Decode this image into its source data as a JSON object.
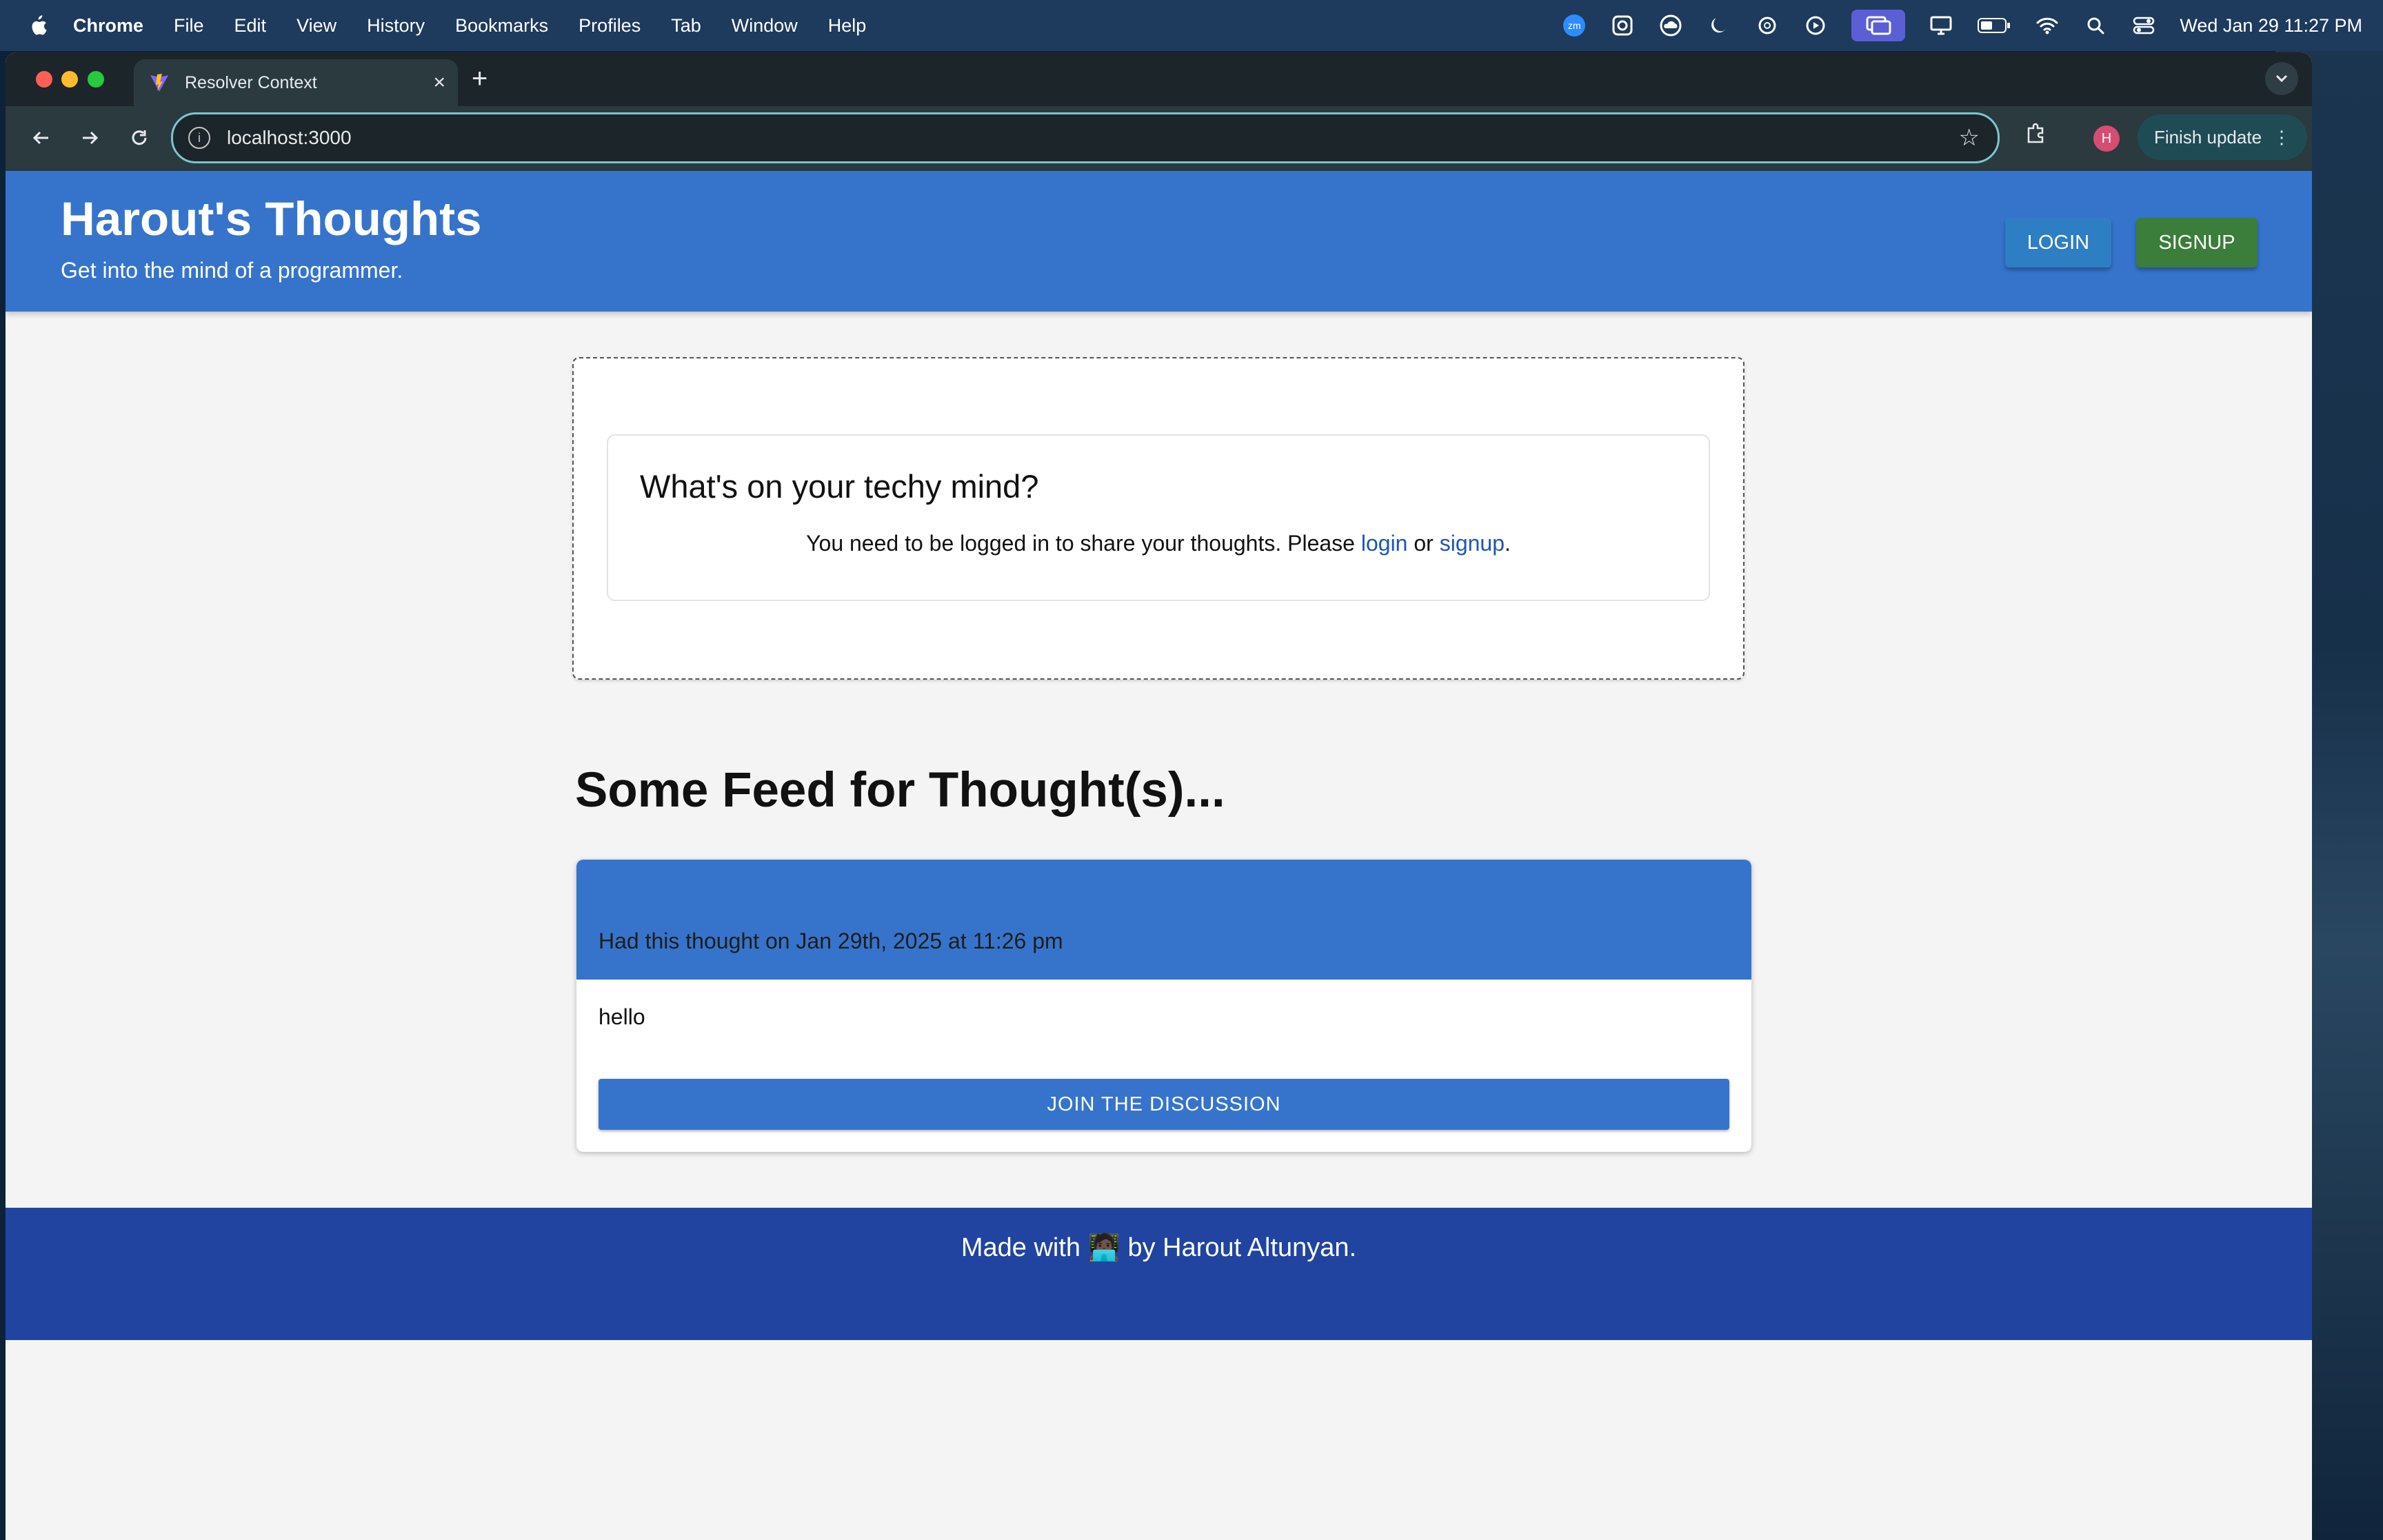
{
  "menubar": {
    "app_name": "Chrome",
    "menus": [
      "File",
      "Edit",
      "View",
      "History",
      "Bookmarks",
      "Profiles",
      "Tab",
      "Window",
      "Help"
    ],
    "clock": "Wed Jan 29  11:27 PM",
    "zoom_badge": "zm"
  },
  "browser": {
    "tab_title": "Resolver Context",
    "url": "localhost:3000",
    "profile_initial": "H",
    "finish_update_label": "Finish update"
  },
  "site": {
    "title": "Harout's Thoughts",
    "tagline": "Get into the mind of a programmer.",
    "login_label": "LOGIN",
    "signup_label": "SIGNUP"
  },
  "composer": {
    "heading": "What's on your techy mind?",
    "message_prefix": "You need to be logged in to share your thoughts. Please ",
    "login_link": "login",
    "or_text": " or ",
    "signup_link": "signup",
    "message_suffix": "."
  },
  "feed": {
    "title": "Some Feed for Thought(s)...",
    "thoughts": [
      {
        "date_text": "Had this thought on Jan 29th, 2025 at 11:26 pm",
        "body": "hello",
        "join_label": "JOIN THE DISCUSSION"
      }
    ]
  },
  "footer": {
    "text": "Made with 🧑🏿‍💻 by Harout Altunyan."
  },
  "colors": {
    "header_blue": "#3674cc",
    "footer_blue": "#2044a0",
    "login_button": "#2e7ec4",
    "signup_button": "#3b7d3a",
    "link": "#1d56b5"
  }
}
